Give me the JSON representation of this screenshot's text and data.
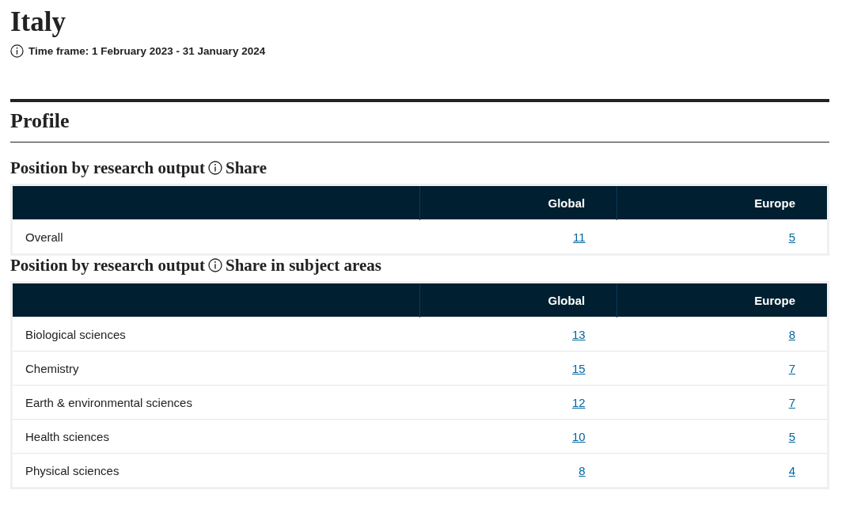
{
  "title": "Italy",
  "time_frame": "Time frame: 1 February 2023 - 31 January 2024",
  "section": {
    "title": "Profile"
  },
  "tables": [
    {
      "heading_before": "Position by research output",
      "heading_after": "Share",
      "columns": [
        "Global",
        "Europe"
      ],
      "rows": [
        {
          "label": "Overall",
          "global": "11",
          "europe": "5"
        }
      ]
    },
    {
      "heading_before": "Position by research output",
      "heading_after": "Share in subject areas",
      "columns": [
        "Global",
        "Europe"
      ],
      "rows": [
        {
          "label": "Biological sciences",
          "global": "13",
          "europe": "8"
        },
        {
          "label": "Chemistry",
          "global": "15",
          "europe": "7"
        },
        {
          "label": "Earth & environmental sciences",
          "global": "12",
          "europe": "7"
        },
        {
          "label": "Health sciences",
          "global": "10",
          "europe": "5"
        },
        {
          "label": "Physical sciences",
          "global": "8",
          "europe": "4"
        }
      ]
    }
  ]
}
